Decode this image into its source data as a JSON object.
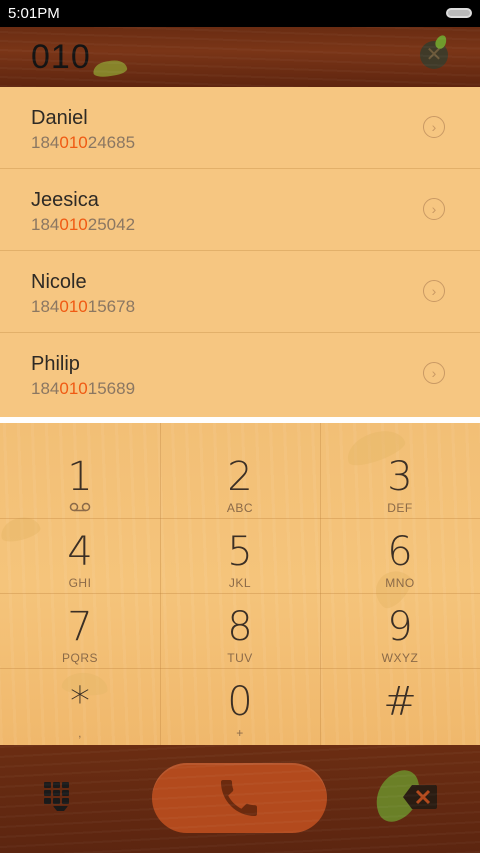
{
  "status_bar": {
    "time": "5:01PM",
    "battery_icon": "battery-icon"
  },
  "header": {
    "query": "010",
    "clear_icon": "clear-icon"
  },
  "results": [
    {
      "name": "Daniel",
      "pre": "184",
      "match": "010",
      "post": "24685"
    },
    {
      "name": "Jeesica",
      "pre": "184",
      "match": "010",
      "post": "25042"
    },
    {
      "name": "Nicole",
      "pre": "184",
      "match": "010",
      "post": "15678"
    },
    {
      "name": "Philip",
      "pre": "184",
      "match": "010",
      "post": "15689"
    }
  ],
  "keypad": {
    "keys": [
      {
        "digit": "1",
        "letters": ""
      },
      {
        "digit": "2",
        "letters": "ABC"
      },
      {
        "digit": "3",
        "letters": "DEF"
      },
      {
        "digit": "4",
        "letters": "GHI"
      },
      {
        "digit": "5",
        "letters": "JKL"
      },
      {
        "digit": "6",
        "letters": "MNO"
      },
      {
        "digit": "7",
        "letters": "PQRS"
      },
      {
        "digit": "8",
        "letters": "TUV"
      },
      {
        "digit": "9",
        "letters": "WXYZ"
      },
      {
        "digit": "*",
        "letters": ","
      },
      {
        "digit": "0",
        "letters": "+"
      },
      {
        "digit": "#",
        "letters": ""
      }
    ]
  },
  "colors": {
    "highlight": "#f05a13",
    "list_bg": "#f6c681",
    "wood_dark": "#6a2c12",
    "call_button": "#b34a1d"
  },
  "icons": {
    "voicemail": "voicemail-icon",
    "dialpad": "dialpad-toggle-icon",
    "call": "phone-icon",
    "delete": "backspace-icon",
    "row_action": "chevron-right-icon"
  }
}
